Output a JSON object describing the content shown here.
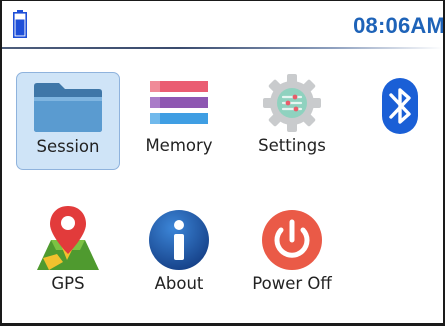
{
  "status_bar": {
    "time": "08:06AM",
    "battery_icon": "battery-icon",
    "accent": "#1e63b8"
  },
  "menu": {
    "items": [
      {
        "label": "Session",
        "icon": "folder-icon",
        "selected": true
      },
      {
        "label": "Memory",
        "icon": "memory-stack-icon",
        "selected": false
      },
      {
        "label": "Settings",
        "icon": "gear-icon",
        "selected": false
      },
      {
        "label": "",
        "icon": "bluetooth-icon",
        "selected": false
      },
      {
        "label": "GPS",
        "icon": "map-pin-icon",
        "selected": false
      },
      {
        "label": "About",
        "icon": "info-icon",
        "selected": false
      },
      {
        "label": "Power Off",
        "icon": "power-icon",
        "selected": false
      }
    ]
  },
  "colors": {
    "selection_bg": "#cfe4f7",
    "power": "#ea5a47",
    "bluetooth": "#1a5fd6"
  }
}
